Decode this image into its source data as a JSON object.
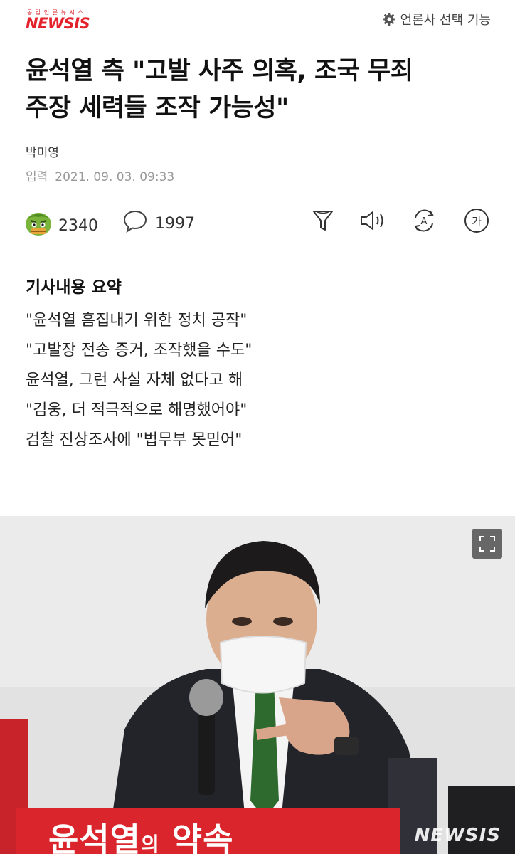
{
  "header": {
    "logo_tagline": "공 감 언 론 뉴 시 스",
    "logo_text": "NEWSIS",
    "press_select_label": "언론사 선택 기능"
  },
  "article": {
    "headline_line1": "윤석열 측 \"고발 사주 의혹, 조국 무죄",
    "headline_line2": "주장 세력들 조작 가능성\"",
    "author": "박미영",
    "date_label": "입력",
    "date_value": "2021. 09. 03. 09:33"
  },
  "actions": {
    "reaction_count": "2340",
    "comment_count": "1997",
    "font_button_label": "가",
    "translate_button_label": "A"
  },
  "summary": {
    "title": "기사내용 요약",
    "items": [
      "\"윤석열 흠집내기 위한 정치 공작\"",
      "\"고발장 전송 증거, 조작했을 수도\"",
      "윤석열, 그런 사실 자체 없다고 해",
      "\"김웅, 더 적극적으로 해명했어야\"",
      "검찰 진상조사에 \"법무부 못믿어\""
    ]
  },
  "photo": {
    "banner_main": "윤석열",
    "banner_particle": "의",
    "banner_end": " 약속",
    "watermark": "NEWSIS"
  },
  "colors": {
    "brand_red": "#e3222c",
    "banner_red": "#d9252b",
    "text_dark": "#111111",
    "text_muted": "#999999"
  }
}
